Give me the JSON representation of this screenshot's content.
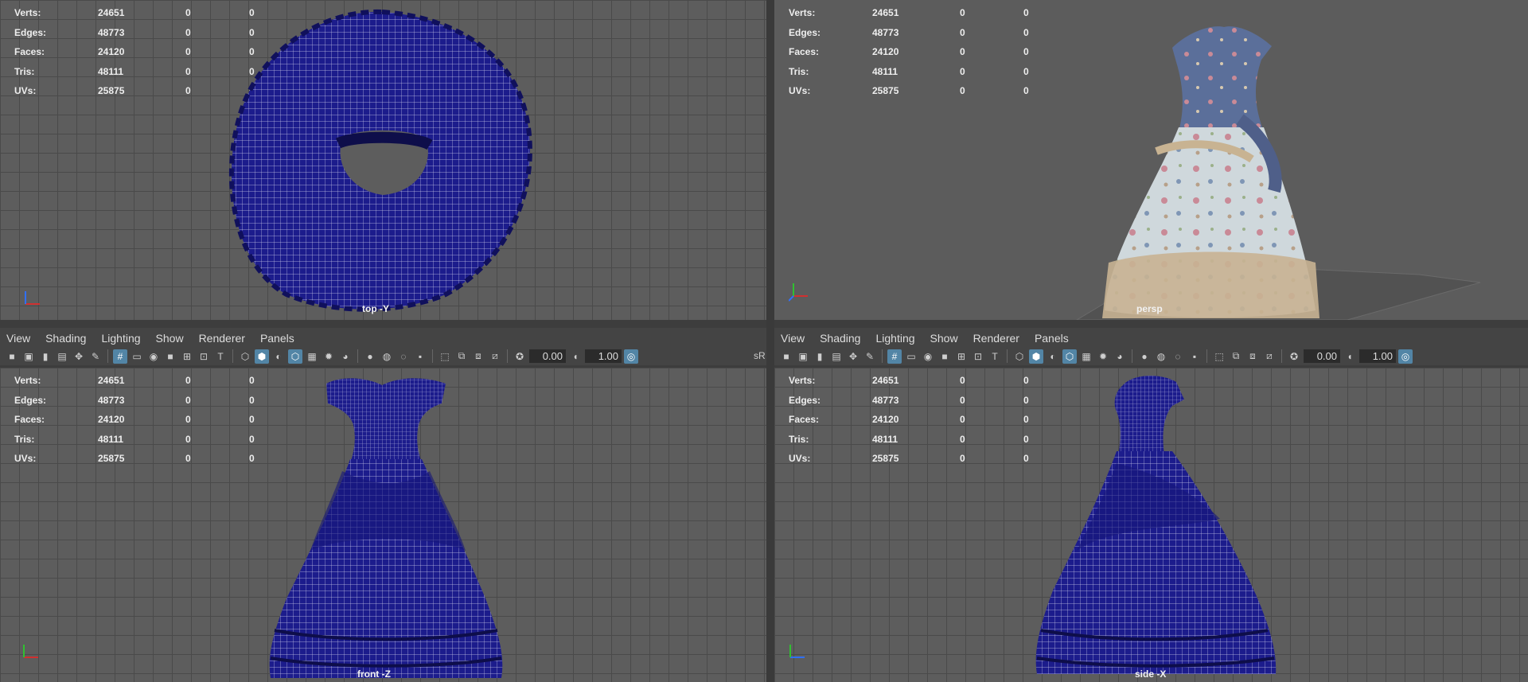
{
  "hud": {
    "rows": [
      {
        "label": "Verts:",
        "a": "24651",
        "b": "0",
        "c": "0"
      },
      {
        "label": "Edges:",
        "a": "48773",
        "b": "0",
        "c": "0"
      },
      {
        "label": "Faces:",
        "a": "24120",
        "b": "0",
        "c": "0"
      },
      {
        "label": "Tris:",
        "a": "48111",
        "b": "0",
        "c": "0"
      },
      {
        "label": "UVs:",
        "a": "25875",
        "b": "0",
        "c": "0"
      }
    ]
  },
  "menus": {
    "view": "View",
    "shading": "Shading",
    "lighting": "Lighting",
    "show": "Show",
    "renderer": "Renderer",
    "panels": "Panels"
  },
  "toolbar": {
    "exposure": "0.00",
    "gamma": "1.00",
    "srgb_label": "sR"
  },
  "cameras": {
    "top": "top -Y",
    "persp": "persp",
    "front": "front -Z",
    "side": "side -X"
  },
  "axis": {
    "x": "x",
    "y": "y",
    "z": "z"
  },
  "colors": {
    "wire": "#1c1c8c",
    "viewport_bg": "#5d5d5d",
    "grid": "#4a4a4a",
    "axis_x": "#d03030",
    "axis_y": "#30c030",
    "axis_z": "#3070ff",
    "toggle_on": "#5285a6"
  }
}
